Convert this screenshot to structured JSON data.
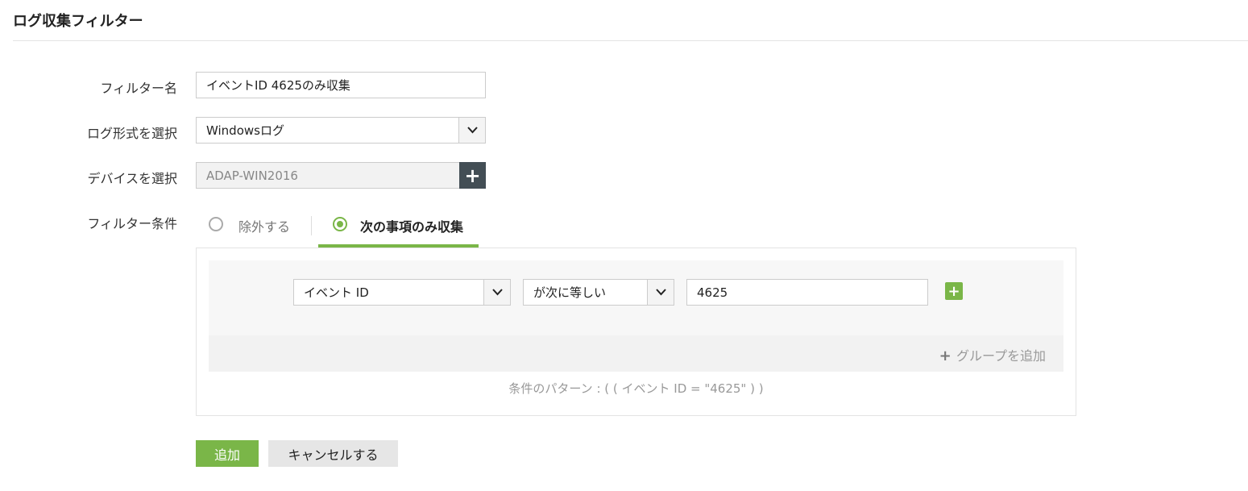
{
  "title": "ログ収集フィルター",
  "labels": {
    "filter_name": "フィルター名",
    "log_format": "ログ形式を選択",
    "device": "デバイスを選択",
    "condition": "フィルター条件"
  },
  "filter_name_value": "イベントID 4625のみ収集",
  "log_format_value": "Windowsログ",
  "device_value": "ADAP-WIN2016",
  "radio": {
    "exclude": "除外する",
    "include_only": "次の事項のみ収集"
  },
  "rule": {
    "field": "イベント ID",
    "operator": "が次に等しい",
    "value": "4625"
  },
  "add_group": "グループを追加",
  "pattern": "条件のパターン : ( ( イベント ID = \"4625\" ) )",
  "buttons": {
    "add": "追加",
    "cancel": "キャンセルする"
  },
  "colors": {
    "accent": "#7ab648",
    "dark": "#434e55"
  }
}
